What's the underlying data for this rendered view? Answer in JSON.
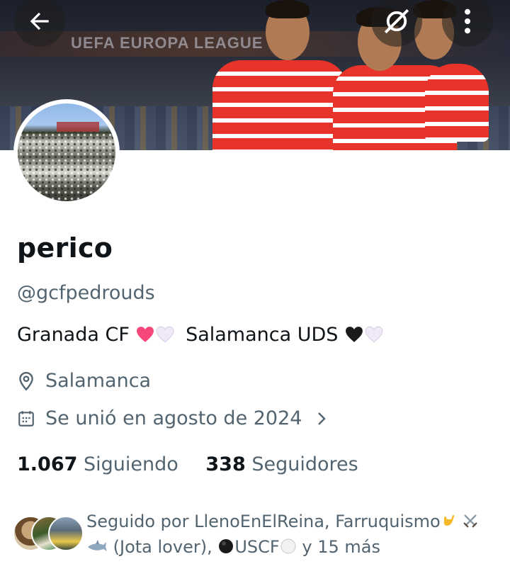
{
  "banner": {
    "watermark_text": "UEFA EUROPA LEAGUE",
    "team_color": "#e8332a"
  },
  "header": {
    "back_icon": "arrow-left-icon",
    "mute_icon": "no-signal-icon",
    "more_icon": "more-vertical-icon"
  },
  "profile": {
    "display_name": "perico",
    "handle": "@gcfpedrouds",
    "bio_part1": "Granada CF",
    "bio_part2": "Salamanca UDS",
    "location": "Salamanca",
    "joined": "Se unió en agosto de 2024",
    "following_count": "1.067",
    "following_label": "Siguiendo",
    "followers_count": "338",
    "followers_label": "Seguidores"
  },
  "followed_by": {
    "line1": "Seguido por LlenoEnElReina, Farruquismo",
    "line2a": "(Jota lover),",
    "line2b": "USCF",
    "line2c": "y 15 más"
  },
  "colors": {
    "text_primary": "#0f1419",
    "text_secondary": "#536471",
    "heart_red": "#f7467a",
    "heart_white": "#efe8f6",
    "heart_black": "#1a1a1a"
  }
}
